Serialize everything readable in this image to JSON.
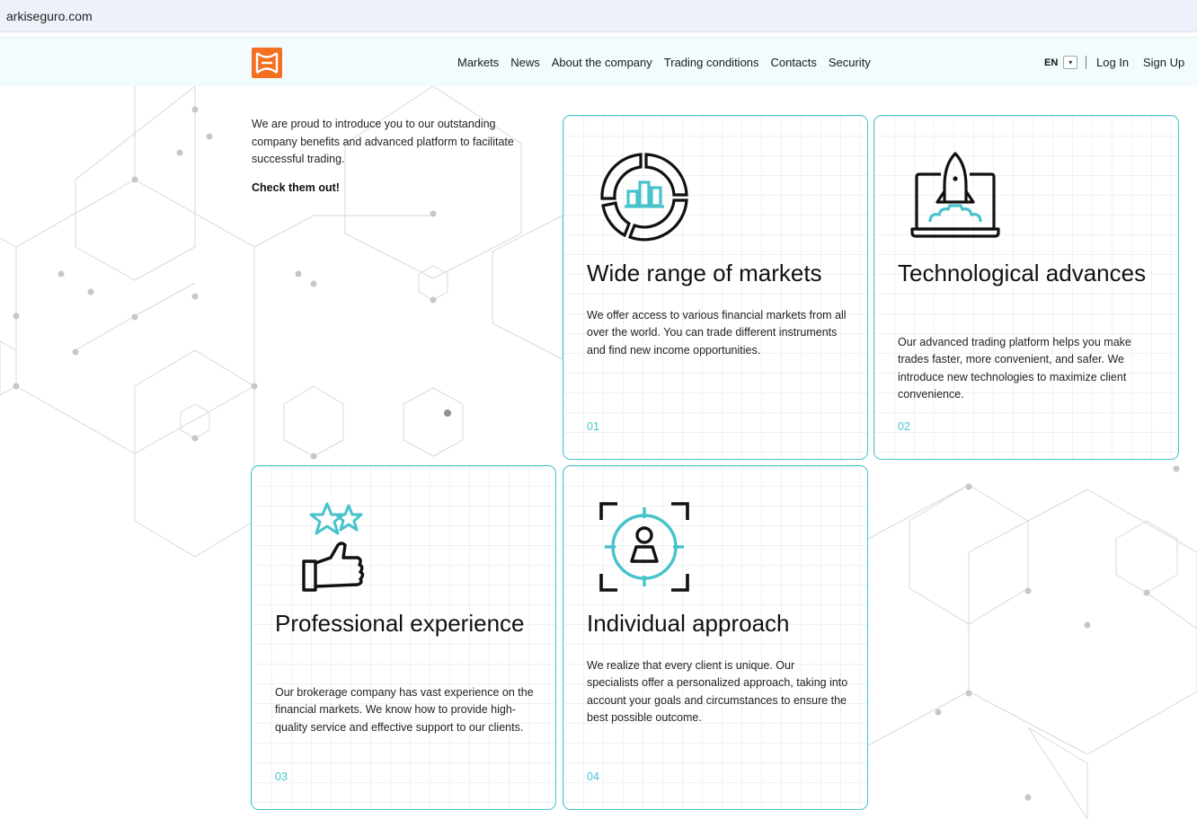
{
  "browser": {
    "url": "arkiseguro.com"
  },
  "header": {
    "nav": [
      "Markets",
      "News",
      "About the company",
      "Trading conditions",
      "Contacts",
      "Security"
    ],
    "language": "EN",
    "login_label": "Log In",
    "signup_label": "Sign Up"
  },
  "intro": {
    "text": "We are proud to introduce you to our outstanding company benefits and advanced platform to facilitate successful trading.",
    "cta": "Check them out!"
  },
  "cards": [
    {
      "title": "Wide range of markets",
      "description": "We offer access to various financial markets from all over the world. You can trade different instruments and find new income opportunities.",
      "number": "01",
      "icon": "chart-ring-icon"
    },
    {
      "title": "Technological advances",
      "description": "Our advanced trading platform helps you make trades faster, more convenient, and safer. We introduce new technologies to maximize client convenience.",
      "number": "02",
      "icon": "rocket-laptop-icon"
    },
    {
      "title": "Professional experience",
      "description": "Our brokerage company has vast experience on the financial markets. We know how to provide high-quality service and effective support to our clients.",
      "number": "03",
      "icon": "thumbs-up-stars-icon"
    },
    {
      "title": "Individual approach",
      "description": "We realize that every client is unique. Our specialists offer a personalized approach, taking into account your goals and circumstances to ensure the best possible outcome.",
      "number": "04",
      "icon": "target-person-icon"
    }
  ],
  "colors": {
    "accent": "#46c3cc",
    "logo": "#f37021",
    "header_bg": "#f2fcfd",
    "urlbar_bg": "#eef1f9"
  }
}
